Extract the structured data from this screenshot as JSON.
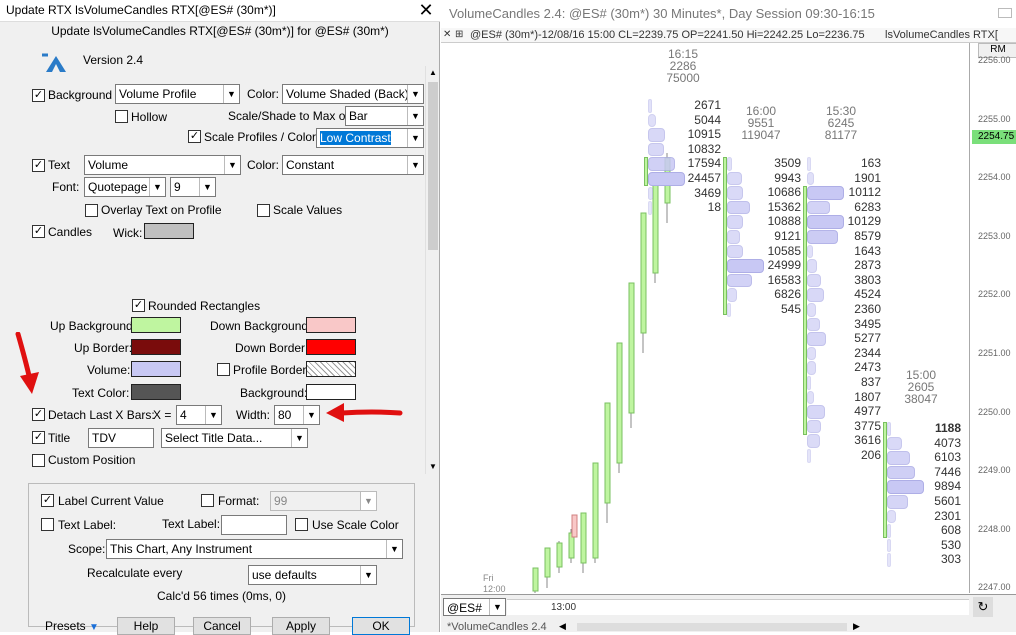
{
  "dialog": {
    "title": "Update RTX lsVolumeCandles RTX[@ES# (30m*)]",
    "subtitle": "Update lsVolumeCandles RTX[@ES# (30m*)] for @ES# (30m*)",
    "version": "Version 2.4",
    "background": {
      "label": "Background",
      "value": "Volume Profile",
      "color_label": "Color:",
      "color_value": "Volume Shaded (Back)"
    },
    "hollow": "Hollow",
    "scale_shade": {
      "label": "Scale/Shade to Max of:",
      "value": "Bar"
    },
    "scale_profiles": {
      "label": "Scale Profiles / Colors",
      "value": "Low Contrast"
    },
    "text": {
      "label": "Text",
      "value": "Volume",
      "color_label": "Color:",
      "color_value": "Constant"
    },
    "font": {
      "label": "Font:",
      "value": "Quotepage",
      "size": "9"
    },
    "overlay": "Overlay Text on Profile",
    "scale_values": "Scale Values",
    "candles": "Candles",
    "wick": "Wick:",
    "rounded": "Rounded Rectangles",
    "up_bg": "Up Background:",
    "down_bg": "Down Background:",
    "up_border": "Up Border:",
    "down_border": "Down Border:",
    "volume": "Volume:",
    "profile_border": "Profile Border:",
    "text_color": "Text Color:",
    "background2": "Background:",
    "detach": {
      "label": "Detach Last X Bars:",
      "x_label": "X =",
      "x_value": "4",
      "width_label": "Width:",
      "width_value": "80"
    },
    "title_row": {
      "label": "Title",
      "value": "TDV",
      "select": "Select Title Data..."
    },
    "custom_position": "Custom Position",
    "label_current": "Label Current Value",
    "format": {
      "label": "Format:",
      "value": "99"
    },
    "text_label_cb": "Text Label:",
    "text_label": "Text Label:",
    "use_scale_color": "Use Scale Color",
    "scope": {
      "label": "Scope:",
      "value": "This Chart, Any Instrument"
    },
    "recalc": {
      "label": "Recalculate every",
      "value": "use defaults"
    },
    "calcd": "Calc'd 56 times (0ms, 0)",
    "buttons": {
      "presets": "Presets",
      "help": "Help",
      "cancel": "Cancel",
      "apply": "Apply",
      "ok": "OK"
    }
  },
  "colors": {
    "up_bg": "#bff5a0",
    "down_bg": "#f9c8c8",
    "up_border": "#7a0c0c",
    "down_border": "#ff0000",
    "volume": "#c8c8f4",
    "text_color": "#555555",
    "wick": "#c0c0c0"
  },
  "chart": {
    "title": "VolumeCandles 2.4: @ES# (30m*) 30 Minutes*, Day Session 09:30-16:15",
    "info": "@ES# (30m*)-12/08/16 15:00 CL=2239.75 OP=2241.50 Hi=2242.25 Lo=2236.75",
    "study": "lsVolumeCandles RTX[",
    "rm": "RM",
    "y_ticks": [
      "2256.00",
      "2255.00",
      "2254.00",
      "2253.00",
      "2252.00",
      "2251.00",
      "2250.00",
      "2249.00",
      "2248.00",
      "2247.00"
    ],
    "last_price": "2254.75",
    "x_label": "13:00",
    "fri": "Fri",
    "fri_time": "12:00",
    "symbol": "@ES#",
    "tab": "*VolumeCandles 2.4",
    "headers": [
      {
        "time": "16:15",
        "close": "2286",
        "volume": "75000"
      },
      {
        "time": "16:00",
        "close": "9551",
        "volume": "119047"
      },
      {
        "time": "15:30",
        "close": "6245",
        "volume": "81177"
      },
      {
        "time": "15:00",
        "close": "2605",
        "volume": "38047"
      }
    ],
    "col1": [
      "2671",
      "5044",
      "10915",
      "10832",
      "17594",
      "24457",
      "3469",
      "18"
    ],
    "col2": [
      "3509",
      "9943",
      "10686",
      "15362",
      "10888",
      "9121",
      "10585",
      "24999",
      "16583",
      "6826",
      "545"
    ],
    "col3": [
      "163",
      "1901",
      "10112",
      "6283",
      "10129",
      "8579",
      "1643",
      "2873",
      "3803",
      "4524",
      "2360",
      "3495",
      "5277",
      "2344",
      "2473",
      "837",
      "1807",
      "4977",
      "3775",
      "3616",
      "206"
    ],
    "col4": [
      "1188",
      "4073",
      "6103",
      "7446",
      "9894",
      "5601",
      "2301",
      "608",
      "530",
      "303"
    ]
  }
}
